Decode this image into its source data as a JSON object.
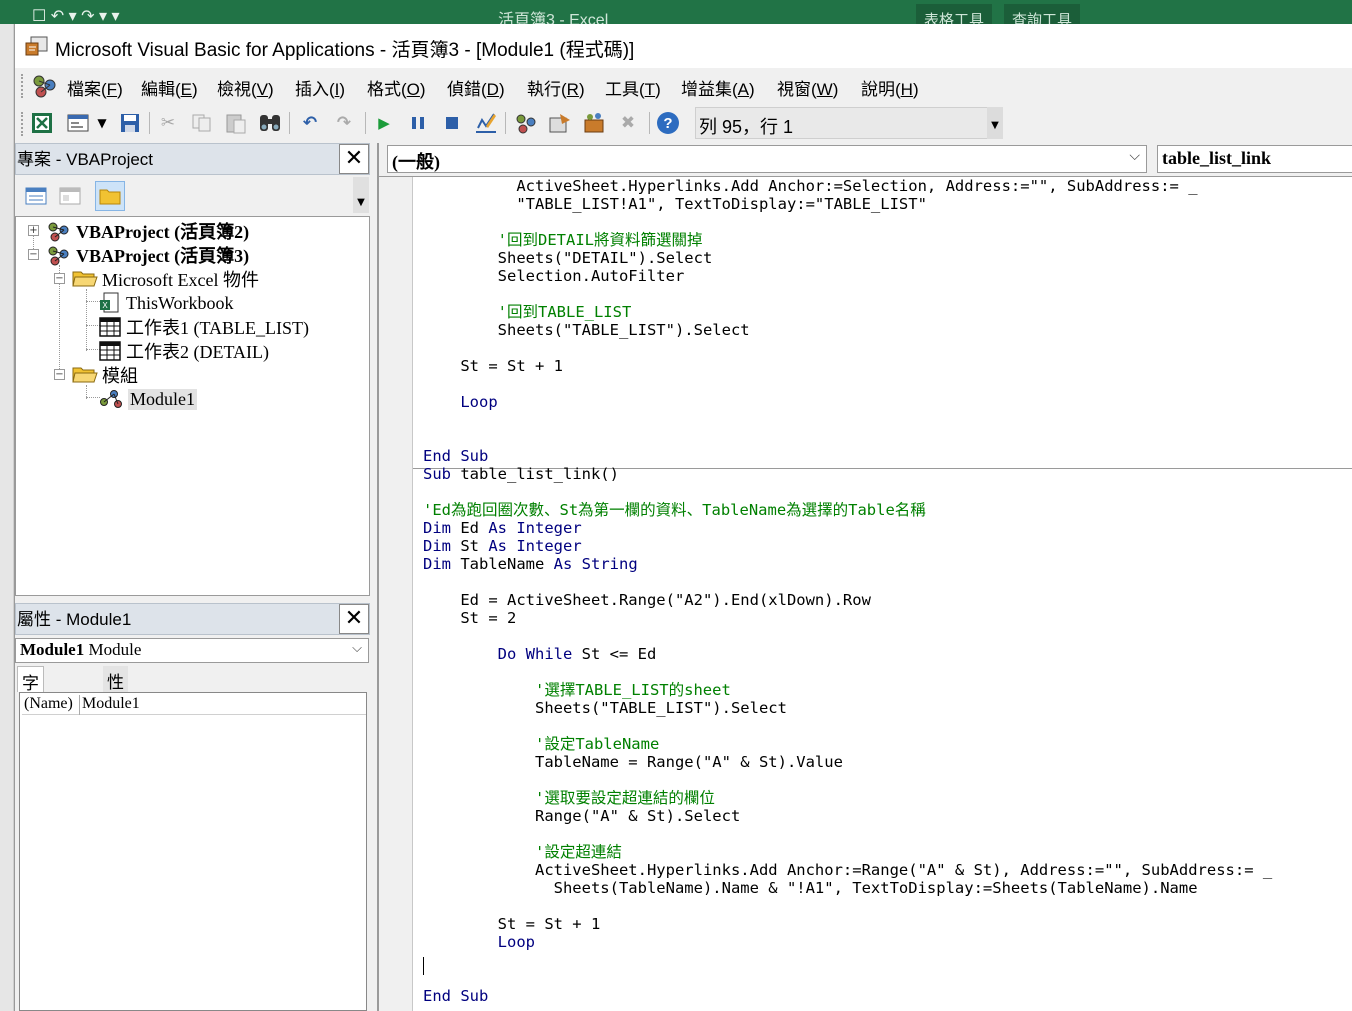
{
  "excel": {
    "title": "活頁簿3 - Excel",
    "context_tabs": [
      "表格工具",
      "查詢工具"
    ]
  },
  "window": {
    "title": "Microsoft Visual Basic for Applications - 活頁簿3 - [Module1 (程式碼)]"
  },
  "menu": [
    {
      "label": "檔案(",
      "key": "F",
      "end": ")"
    },
    {
      "label": "編輯(",
      "key": "E",
      "end": ")"
    },
    {
      "label": "檢視(",
      "key": "V",
      "end": ")"
    },
    {
      "label": "插入(",
      "key": "I",
      "end": ")"
    },
    {
      "label": "格式(",
      "key": "O",
      "end": ")"
    },
    {
      "label": "偵錯(",
      "key": "D",
      "end": ")"
    },
    {
      "label": "執行(",
      "key": "R",
      "end": ")"
    },
    {
      "label": "工具(",
      "key": "T",
      "end": ")"
    },
    {
      "label": "增益集(",
      "key": "A",
      "end": ")"
    },
    {
      "label": "視窗(",
      "key": "W",
      "end": ")"
    },
    {
      "label": "說明(",
      "key": "H",
      "end": ")"
    }
  ],
  "toolbar": {
    "position_text": "列 95，行 1"
  },
  "project": {
    "title": "專案 - VBAProject",
    "close": "✕",
    "nodes": [
      "VBAProject (活頁簿2)",
      "VBAProject (活頁簿3)",
      "Microsoft Excel 物件",
      "ThisWorkbook",
      "工作表1 (TABLE_LIST)",
      "工作表2 (DETAIL)",
      "模組",
      "Module1"
    ]
  },
  "properties": {
    "title": "屬性 - Module1",
    "close": "✕",
    "object_bold": "Module1",
    "object_type": " Module",
    "tabs": [
      "字母順序",
      "性質分類"
    ],
    "rows": [
      {
        "name": "(Name)",
        "value": "Module1"
      }
    ]
  },
  "code": {
    "object_combo": "(一般)",
    "proc_combo": "table_list_link",
    "lines": [
      "          ActiveSheet.Hyperlinks.Add Anchor:=Selection, Address:=\"\", SubAddress:= _",
      "          \"TABLE_LIST!A1\", TextToDisplay:=\"TABLE_LIST\"",
      "",
      "        '回到DETAIL將資料篩選關掉",
      "        Sheets(\"DETAIL\").Select",
      "        Selection.AutoFilter",
      "",
      "        '回到TABLE_LIST",
      "        Sheets(\"TABLE_LIST\").Select",
      "",
      "    St = St + 1",
      "",
      "    Loop",
      "",
      "",
      "End Sub",
      "Sub table_list_link()",
      "",
      "'Ed為跑回圈次數、St為第一欄的資料、TableName為選擇的Table名稱",
      "Dim Ed As Integer",
      "Dim St As Integer",
      "Dim TableName As String",
      "",
      "    Ed = ActiveSheet.Range(\"A2\").End(xlDown).Row",
      "    St = 2",
      "",
      "        Do While St <= Ed",
      "",
      "            '選擇TABLE_LIST的sheet",
      "            Sheets(\"TABLE_LIST\").Select",
      "",
      "            '設定TableName",
      "            TableName = Range(\"A\" & St).Value",
      "",
      "            '選取要設定超連結的欄位",
      "            Range(\"A\" & St).Select",
      "",
      "            '設定超連結",
      "            ActiveSheet.Hyperlinks.Add Anchor:=Range(\"A\" & St), Address:=\"\", SubAddress:= _",
      "              Sheets(TableName).Name & \"!A1\", TextToDisplay:=Sheets(TableName).Name",
      "",
      "        St = St + 1",
      "        Loop",
      "",
      "",
      "End Sub"
    ]
  }
}
